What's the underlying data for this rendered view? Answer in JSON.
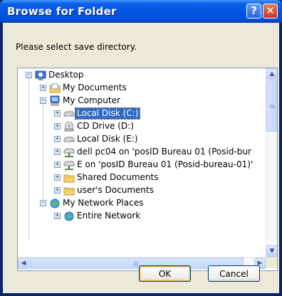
{
  "window": {
    "title": "Browse for Folder"
  },
  "titlebar_buttons": {
    "help": "?",
    "close": "✕"
  },
  "prompt": "Please select save directory.",
  "tree": {
    "items": [
      {
        "label": "Desktop",
        "icon": "desktop-icon",
        "expander": "−"
      },
      {
        "label": "My Documents",
        "icon": "my-documents-icon",
        "expander": "+"
      },
      {
        "label": "My Computer",
        "icon": "my-computer-icon",
        "expander": "−"
      },
      {
        "label": "Local Disk (C:)",
        "icon": "hard-drive-icon",
        "expander": "+",
        "selected": true
      },
      {
        "label": "CD Drive (D:)",
        "icon": "cd-drive-icon",
        "expander": "+"
      },
      {
        "label": "Local Disk (E:)",
        "icon": "hard-drive-icon",
        "expander": "+"
      },
      {
        "label": "dell pc04 on 'posID Bureau 01 (Posid-bur",
        "icon": "network-drive-icon",
        "expander": "+"
      },
      {
        "label": "E on 'posID Bureau 01 (Posid-bureau-01)'",
        "icon": "network-drive-icon",
        "expander": "+"
      },
      {
        "label": "Shared Documents",
        "icon": "folder-icon",
        "expander": "+"
      },
      {
        "label": "user's Documents",
        "icon": "folder-icon",
        "expander": "+"
      },
      {
        "label": "My Network Places",
        "icon": "network-places-icon",
        "expander": "−"
      },
      {
        "label": "Entire Network",
        "icon": "entire-network-icon",
        "expander": "+"
      }
    ]
  },
  "buttons": {
    "ok": "OK",
    "cancel": "Cancel"
  },
  "colors": {
    "selection": "#316ac5",
    "titlebar": "#0054e3",
    "dialog_bg": "#ece9d8"
  }
}
